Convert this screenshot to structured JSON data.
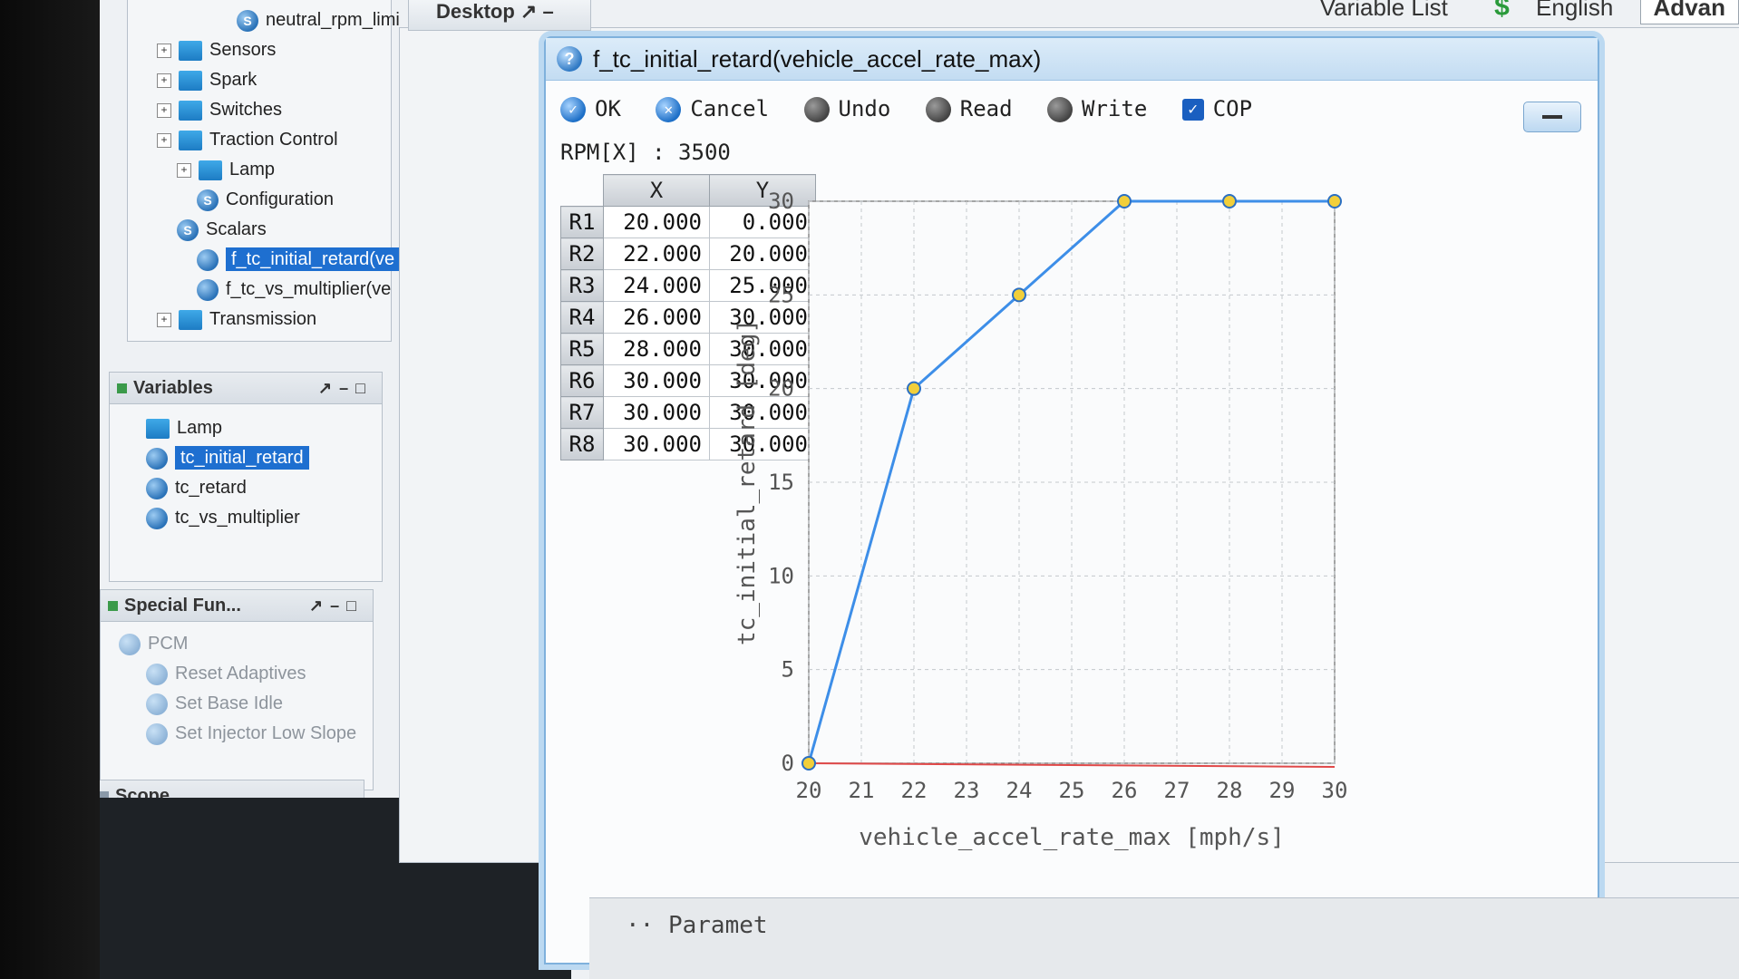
{
  "tree": {
    "items": [
      {
        "label": "neutral_rpm_limi",
        "kind": "scalar",
        "indent": 5
      },
      {
        "label": "Sensors",
        "kind": "folder",
        "indent": 1
      },
      {
        "label": "Spark",
        "kind": "folder",
        "indent": 1
      },
      {
        "label": "Switches",
        "kind": "folder",
        "indent": 1
      },
      {
        "label": "Traction Control",
        "kind": "folder",
        "indent": 1
      },
      {
        "label": "Lamp",
        "kind": "folder",
        "indent": 2
      },
      {
        "label": "Configuration",
        "kind": "scalar",
        "indent": 3
      },
      {
        "label": "Scalars",
        "kind": "scalar",
        "indent": 2
      },
      {
        "label": "f_tc_initial_retard(ve",
        "kind": "table",
        "indent": 3,
        "selected": true
      },
      {
        "label": "f_tc_vs_multiplier(ve",
        "kind": "table",
        "indent": 3
      },
      {
        "label": "Transmission",
        "kind": "folder",
        "indent": 1
      }
    ]
  },
  "variables": {
    "title": "Variables",
    "items": [
      {
        "label": "Lamp",
        "kind": "folder"
      },
      {
        "label": "tc_initial_retard",
        "kind": "var",
        "selected": true
      },
      {
        "label": "tc_retard",
        "kind": "var"
      },
      {
        "label": "tc_vs_multiplier",
        "kind": "var"
      }
    ]
  },
  "special": {
    "title": "Special Fun...",
    "items": [
      "PCM",
      "Reset Adaptives",
      "Set Base Idle",
      "Set Injector Low Slope"
    ]
  },
  "scope": {
    "title": "Scope"
  },
  "desktop": {
    "tab": "Desktop"
  },
  "topbar": {
    "variable_list": "Variable List",
    "language": "English",
    "advanced": "Advan"
  },
  "dialog": {
    "title": "f_tc_initial_retard(vehicle_accel_rate_max)",
    "toolbar": {
      "ok": "OK",
      "cancel": "Cancel",
      "undo": "Undo",
      "read": "Read",
      "write": "Write",
      "cop": "COP"
    },
    "rpm": "RPM[X] : 3500",
    "table": {
      "headers": [
        "X",
        "Y"
      ],
      "rows": [
        {
          "r": "R1",
          "x": "20.000",
          "y": "0.000"
        },
        {
          "r": "R2",
          "x": "22.000",
          "y": "20.000"
        },
        {
          "r": "R3",
          "x": "24.000",
          "y": "25.000"
        },
        {
          "r": "R4",
          "x": "26.000",
          "y": "30.000"
        },
        {
          "r": "R5",
          "x": "28.000",
          "y": "30.000"
        },
        {
          "r": "R6",
          "x": "30.000",
          "y": "30.000"
        },
        {
          "r": "R7",
          "x": "30.000",
          "y": "30.000"
        },
        {
          "r": "R8",
          "x": "30.000",
          "y": "30.000"
        }
      ]
    }
  },
  "chart_data": {
    "type": "line",
    "title": "",
    "xlabel": "vehicle_accel_rate_max [mph/s]",
    "ylabel": "tc_initial_retard [deg]",
    "xlim": [
      20,
      30
    ],
    "ylim": [
      0,
      30
    ],
    "x_ticks": [
      "20",
      "21",
      "22",
      "23",
      "24",
      "25",
      "26",
      "27",
      "28",
      "29",
      "30"
    ],
    "y_ticks": [
      "0",
      "5",
      "10",
      "15",
      "20",
      "25",
      "30"
    ],
    "grid": true,
    "series": [
      {
        "x": [
          20,
          22,
          24,
          26,
          28,
          30
        ],
        "y": [
          0,
          20,
          25,
          30,
          30,
          30
        ],
        "color": "#3d8ee8"
      }
    ],
    "baseline_color": "#e04848"
  },
  "param_bar": "Paramet"
}
